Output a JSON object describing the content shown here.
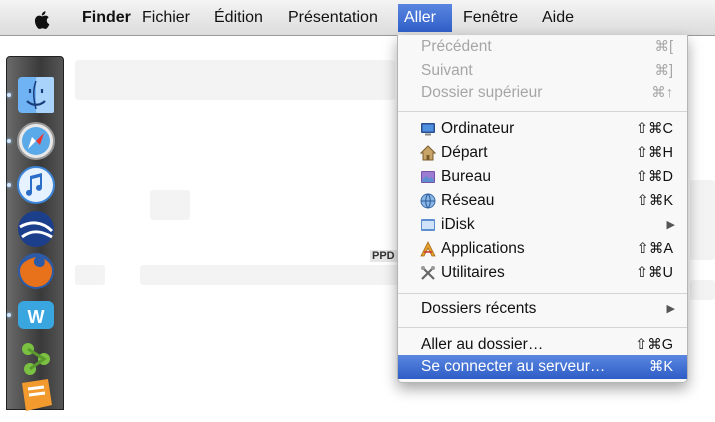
{
  "menubar": {
    "apple_icon": "apple-icon",
    "items": [
      "Finder",
      "Fichier",
      "Édition",
      "Présentation",
      "Aller",
      "Fenêtre",
      "Aide"
    ]
  },
  "desktop": {
    "partial_label": "PPD"
  },
  "dock": {
    "icons": [
      "finder-icon",
      "safari-icon",
      "itunes-icon",
      "google-earth-icon",
      "firefox-icon",
      "wii-icon",
      "network-icon",
      "pages-icon"
    ]
  },
  "menu": {
    "group1": [
      {
        "label": "Précédent",
        "shortcut": "⌘["
      },
      {
        "label": "Suivant",
        "shortcut": "⌘]"
      },
      {
        "label": "Dossier supérieur",
        "shortcut": "⌘↑"
      }
    ],
    "group2": [
      {
        "label": "Ordinateur",
        "shortcut": "⇧⌘C",
        "icon": "computer-icon"
      },
      {
        "label": "Départ",
        "shortcut": "⇧⌘H",
        "icon": "home-icon"
      },
      {
        "label": "Bureau",
        "shortcut": "⇧⌘D",
        "icon": "desktop-icon"
      },
      {
        "label": "Réseau",
        "shortcut": "⇧⌘K",
        "icon": "network-icon"
      },
      {
        "label": "iDisk",
        "shortcut": "▶",
        "icon": "idisk-icon"
      },
      {
        "label": "Applications",
        "shortcut": "⇧⌘A",
        "icon": "applications-icon"
      },
      {
        "label": "Utilitaires",
        "shortcut": "⇧⌘U",
        "icon": "utilities-icon"
      }
    ],
    "recent": {
      "label": "Dossiers récents",
      "shortcut": "▶"
    },
    "group3": [
      {
        "label": "Aller au dossier…",
        "shortcut": "⇧⌘G"
      },
      {
        "label": "Se connecter au serveur…",
        "shortcut": "⌘K"
      }
    ]
  },
  "colors": {
    "highlight": "#3b6fd8",
    "disabled_text": "#a6a6a6"
  }
}
